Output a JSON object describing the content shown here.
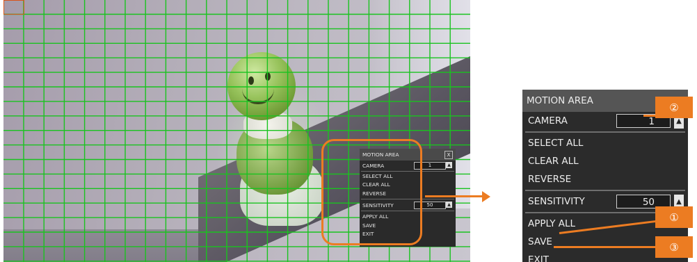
{
  "mini_panel": {
    "title": "MOTION AREA",
    "close": "X",
    "camera_label": "CAMERA",
    "camera_value": "1",
    "select_all": "SELECT ALL",
    "clear_all": "CLEAR ALL",
    "reverse": "REVERSE",
    "sensitivity_label": "SENSITIVITY",
    "sensitivity_value": "50",
    "apply_all": "APPLY ALL",
    "save": "SAVE",
    "exit": "EXIT"
  },
  "zoom_panel": {
    "title": "MOTION AREA",
    "camera_label": "CAMERA",
    "camera_value": "1",
    "select_all": "SELECT ALL",
    "clear_all": "CLEAR ALL",
    "reverse": "REVERSE",
    "sensitivity_label": "SENSITIVITY",
    "sensitivity_value": "50",
    "apply_all": "APPLY ALL",
    "save": "SAVE",
    "exit": "EXIT"
  },
  "callouts": {
    "one": "①",
    "two": "②",
    "three": "③"
  },
  "colors": {
    "accent": "#ec7c22",
    "grid": "#19c31f",
    "panel_bg": "#2b2b2b",
    "panel_header": "#555555"
  },
  "icons": {
    "spin": "spin-up-arrow-icon",
    "close": "close-icon",
    "arrow": "right-arrow-icon"
  }
}
